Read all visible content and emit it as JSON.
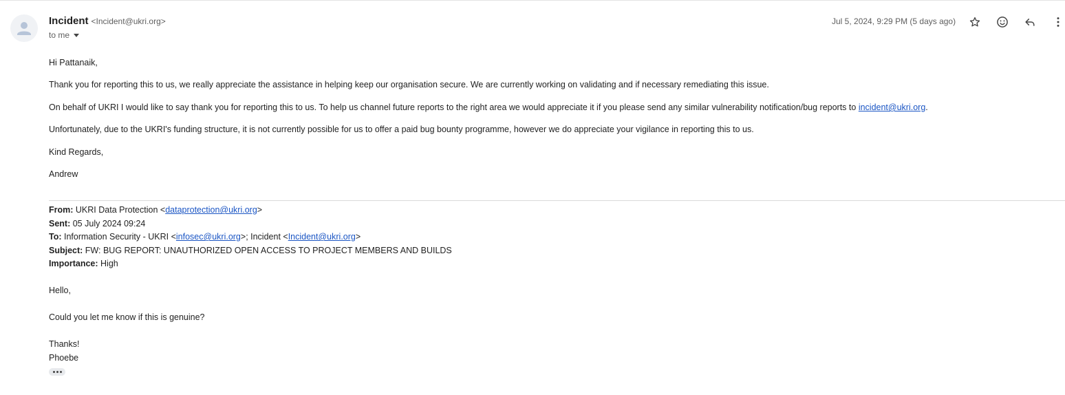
{
  "header": {
    "sender_name": "Incident",
    "sender_email": "<Incident@ukri.org>",
    "recipient": "to me",
    "date": "Jul 5, 2024, 9:29 PM (5 days ago)"
  },
  "icons": {
    "avatar": "person-avatar",
    "star": "star-icon",
    "emoji": "emoji-icon",
    "reply": "reply-icon",
    "more": "more-vert-icon",
    "trim": "show-trimmed-content-icon"
  },
  "message": {
    "greeting": "Hi Pattanaik,",
    "p1": "Thank you for reporting this to us, we really appreciate the assistance in helping keep our organisation secure. We are currently working on validating and if necessary remediating this issue.",
    "p2_text": "On behalf of UKRI I would like to say thank you for reporting this to us. To help us channel future reports to the right area we would appreciate it if you please send any similar vulnerability notification/bug reports to ",
    "p2_link": "incident@ukri.org",
    "p2_end": ".",
    "p3": "Unfortunately, due to the UKRI's funding structure, it is not currently possible for us to offer a paid bug bounty programme, however we do appreciate your vigilance in reporting this to us.",
    "closing": "Kind Regards,",
    "signature": "Andrew"
  },
  "quoted": {
    "from_label": "From:",
    "from_name": "UKRI Data Protection <",
    "from_link": "dataprotection@ukri.org",
    "from_end": ">",
    "sent_label": "Sent:",
    "sent_value": "05 July 2024 09:24",
    "to_label": "To:",
    "to_name1": "Information Security - UKRI <",
    "to_link1": "infosec@ukri.org",
    "to_mid": ">; Incident <",
    "to_link2": "Incident@ukri.org",
    "to_end": ">",
    "subject_label": "Subject:",
    "subject_value": "FW: BUG REPORT: UNAUTHORIZED OPEN ACCESS TO PROJECT MEMBERS AND BUILDS",
    "importance_label": "Importance:",
    "importance_value": "High",
    "hello": "Hello,",
    "question": "Could you let me know if this is genuine?",
    "thanks": "Thanks!",
    "name": "Phoebe"
  }
}
